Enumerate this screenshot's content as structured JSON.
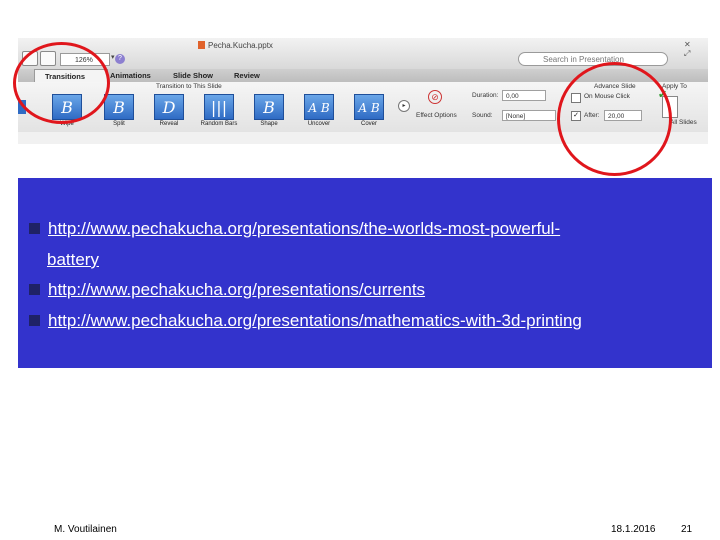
{
  "screenshot": {
    "zoom": "126%",
    "doc_title": "Pecha.Kucha.pptx",
    "search_placeholder": "Search in Presentation",
    "tabs": [
      "Transitions",
      "Animations",
      "Slide Show",
      "Review"
    ],
    "group_title": "Transition to This Slide",
    "transitions": [
      {
        "glyph": "B",
        "label": "Wipe"
      },
      {
        "glyph": "B",
        "label": "Split"
      },
      {
        "glyph": "D",
        "label": "Reveal"
      },
      {
        "glyph": "|||",
        "label": "Random Bars"
      },
      {
        "glyph": "B",
        "label": "Shape"
      },
      {
        "glyph": "A B",
        "label": "Uncover"
      },
      {
        "glyph": "A B",
        "label": "Cover"
      }
    ],
    "duration_label": "Duration:",
    "duration_value": "0,00",
    "effect_options": "Effect Options",
    "sound_label": "Sound:",
    "sound_value": "[None]",
    "advance_title": "Advance Slide",
    "on_mouse_click": "On Mouse Click",
    "after_label": "After:",
    "after_value": "20,00",
    "apply_to": "Apply To",
    "all_slides": "All Slides"
  },
  "links": [
    "http://www.pechakucha.org/presentations/the-worlds-most-powerful-",
    "battery",
    "http://www.pechakucha.org/presentations/currents",
    "http://www.pechakucha.org/presentations/mathematics-with-3d-printing"
  ],
  "footer": {
    "author": "M. Voutilainen",
    "date": "18.1.2016",
    "page": "21"
  },
  "colors": {
    "box": "#3333cc",
    "highlight_circle": "#e0161c"
  }
}
